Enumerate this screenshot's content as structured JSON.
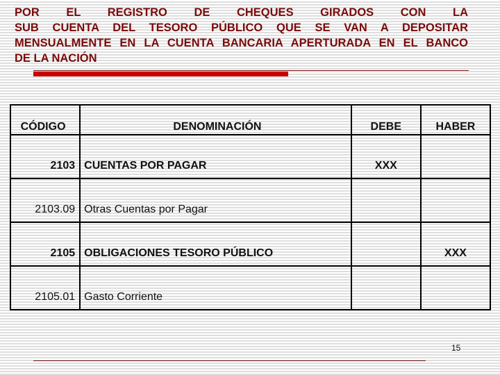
{
  "title": {
    "lines": [
      "POR EL REGISTRO DE CHEQUES GIRADOS CON LA",
      "SUB CUENTA DEL TESORO PÚBLICO QUE SE VAN A DEPOSITAR",
      "MENSUALMENTE EN LA CUENTA BANCARIA APERTURADA EN EL BANCO",
      "DE LA NACIÓN"
    ],
    "color": "#7a0a0a"
  },
  "accent_color": "#c80000",
  "table": {
    "headers": {
      "code": "CÓDIGO",
      "name": "DENOMINACIÓN",
      "debe": "DEBE",
      "haber": "HABER"
    },
    "rows": [
      {
        "code": "2103",
        "name": "CUENTAS POR PAGAR",
        "debe": "XXX",
        "haber": "",
        "bold": true
      },
      {
        "code": "2103.09",
        "name": "Otras Cuentas por Pagar",
        "debe": "",
        "haber": "",
        "bold": false
      },
      {
        "code": "2105",
        "name": "OBLIGACIONES TESORO PÚBLICO",
        "debe": "",
        "haber": "XXX",
        "bold": true
      },
      {
        "code": "2105.01",
        "name": "Gasto Corriente",
        "debe": "",
        "haber": "",
        "bold": false
      }
    ]
  },
  "page_number": "15"
}
